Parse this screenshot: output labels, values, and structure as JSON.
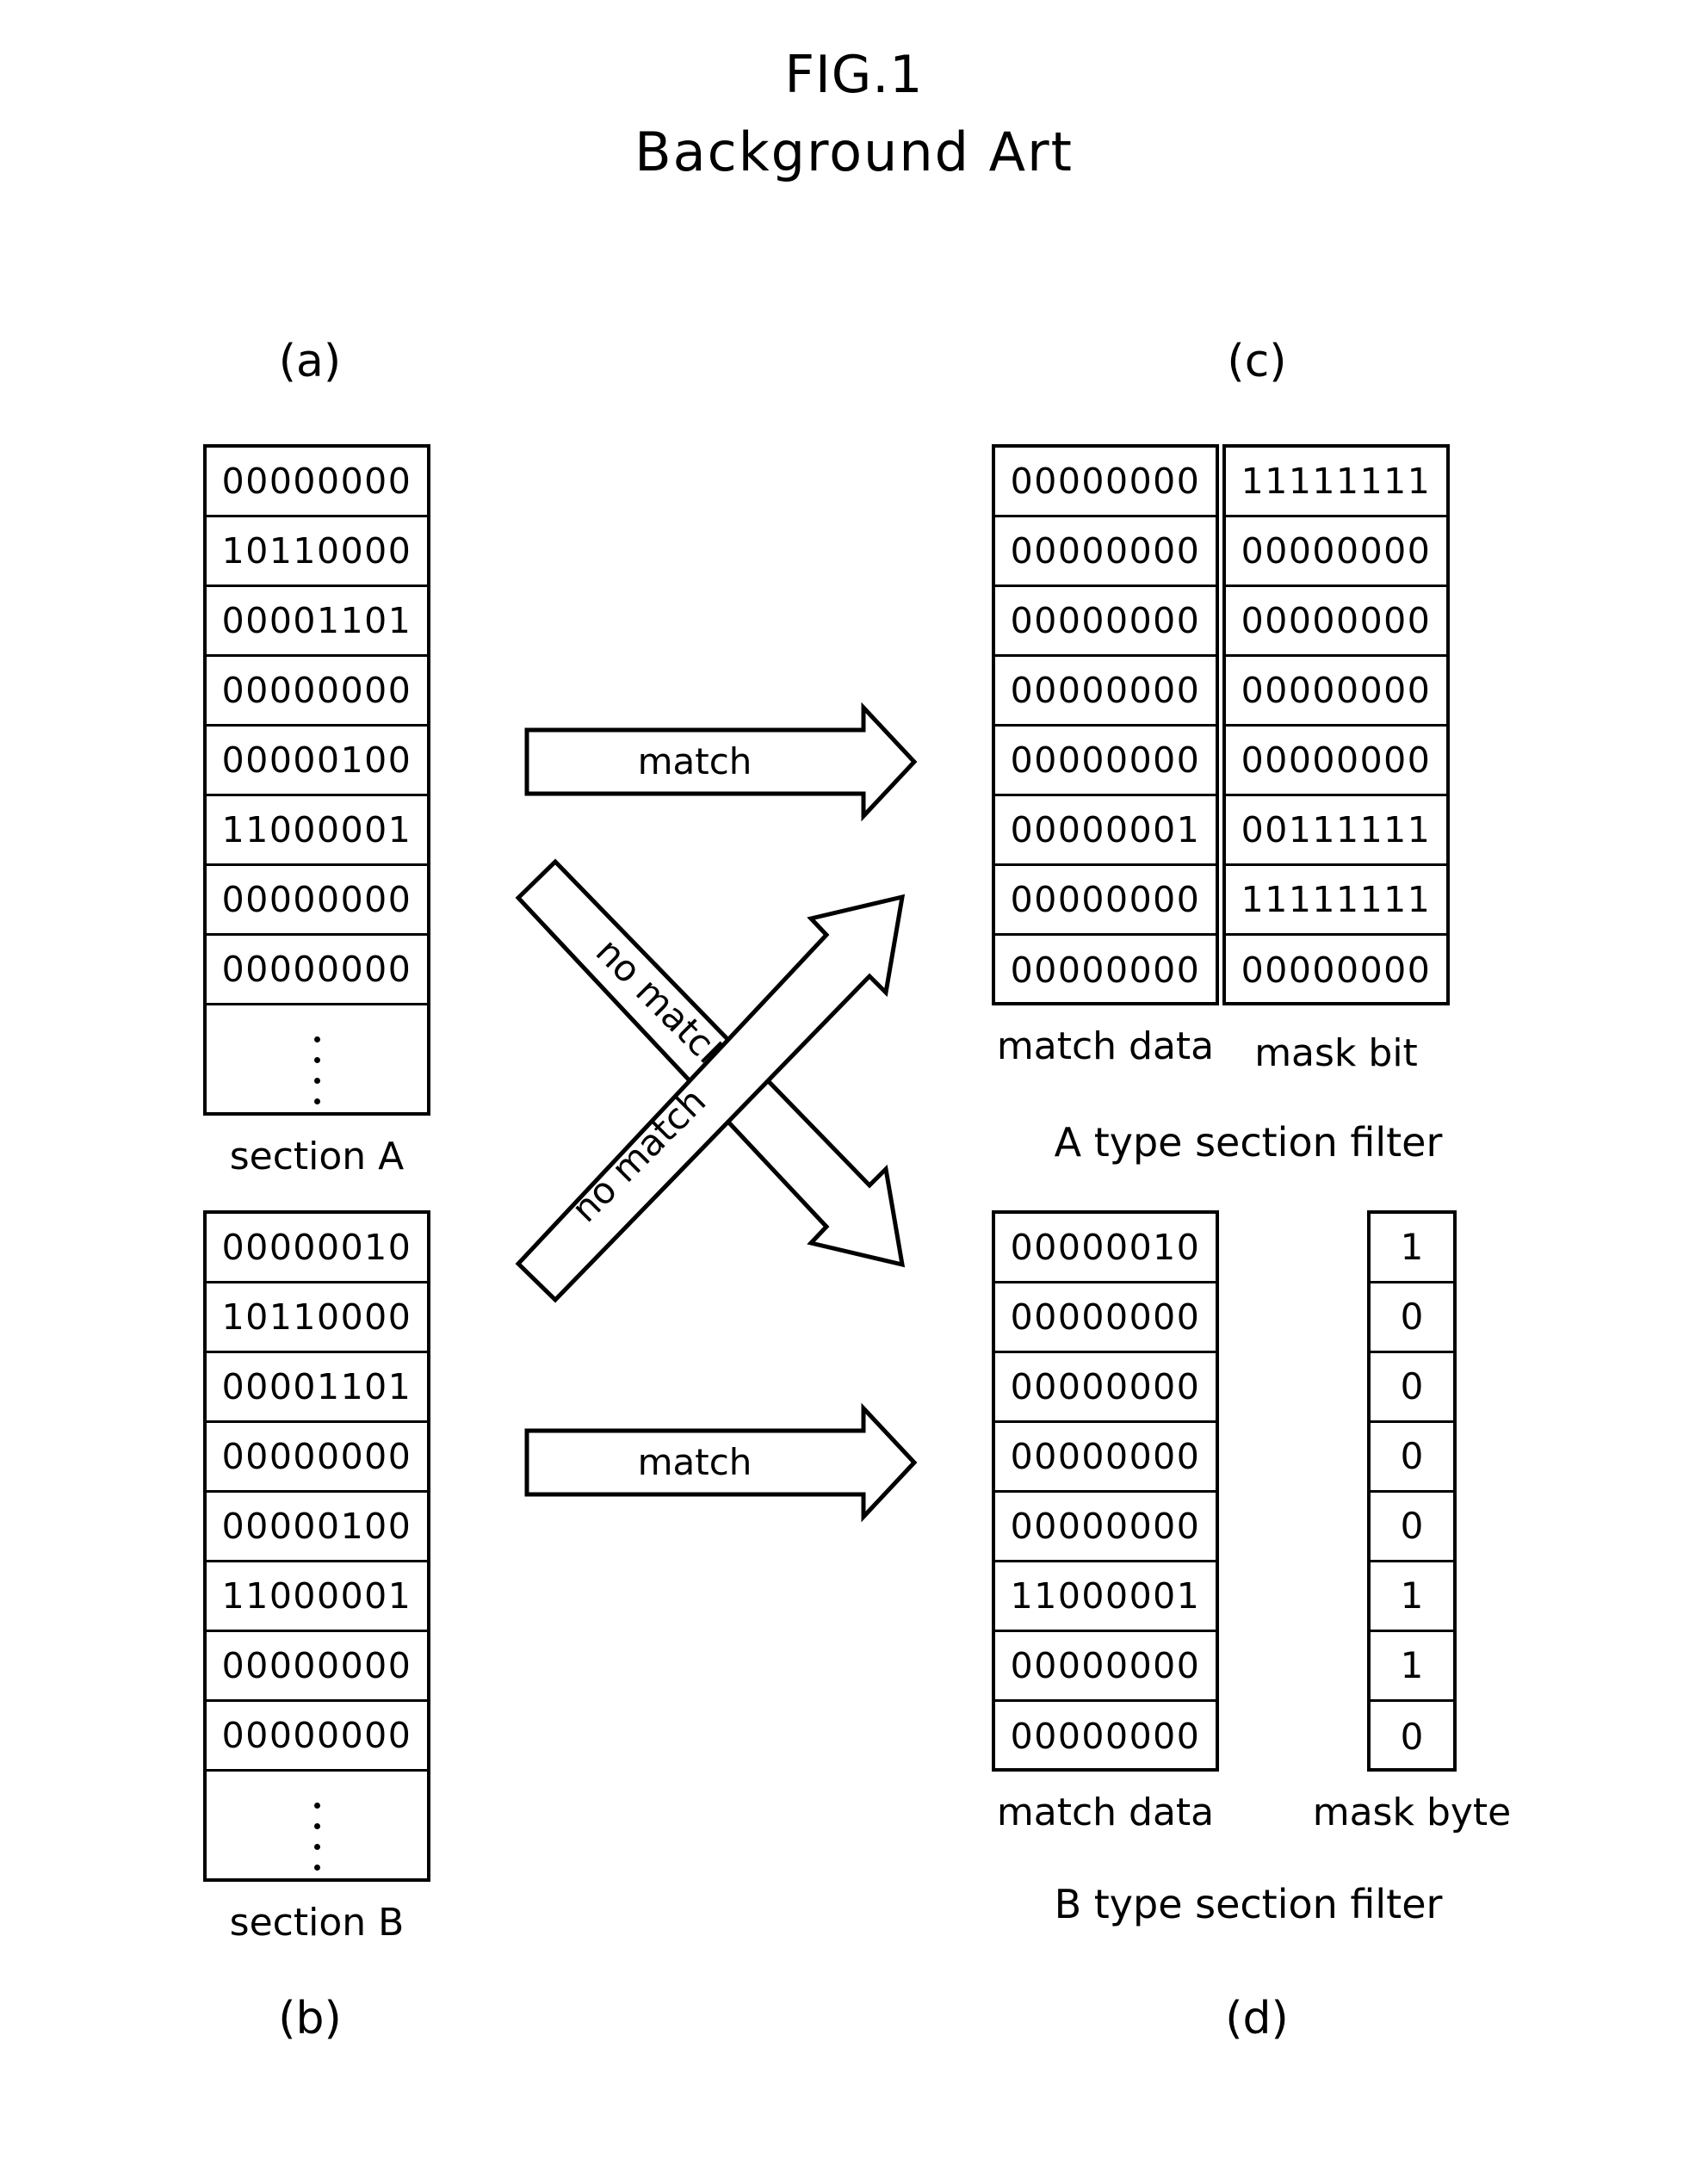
{
  "figure": {
    "title": "FIG.1",
    "subtitle": "Background  Art"
  },
  "panels": {
    "a": "(a)",
    "b": "(b)",
    "c": "(c)",
    "d": "(d)"
  },
  "section_a": {
    "caption": "section  A",
    "rows": [
      "00000000",
      "10110000",
      "00001101",
      "00000000",
      "00000100",
      "11000001",
      "00000000",
      "00000000"
    ],
    "ellipsis_dots": 4
  },
  "section_b": {
    "caption": "section  B",
    "rows": [
      "00000010",
      "10110000",
      "00001101",
      "00000000",
      "00000100",
      "11000001",
      "00000000",
      "00000000"
    ],
    "ellipsis_dots": 4
  },
  "a_type_filter": {
    "title": "A  type  section  filter",
    "match_data_caption": "match  data",
    "mask_caption": "mask  bit",
    "match_data": [
      "00000000",
      "00000000",
      "00000000",
      "00000000",
      "00000000",
      "00000001",
      "00000000",
      "00000000"
    ],
    "mask": [
      "11111111",
      "00000000",
      "00000000",
      "00000000",
      "00000000",
      "00111111",
      "11111111",
      "00000000"
    ]
  },
  "b_type_filter": {
    "title": "B  type  section  filter",
    "match_data_caption": "match  data",
    "mask_caption": "mask  byte",
    "match_data": [
      "00000010",
      "00000000",
      "00000000",
      "00000000",
      "00000000",
      "11000001",
      "00000000",
      "00000000"
    ],
    "mask": [
      "1",
      "0",
      "0",
      "0",
      "0",
      "1",
      "1",
      "0"
    ]
  },
  "arrows": {
    "top_match": "match",
    "bottom_match": "match",
    "cross_down": "no  match",
    "cross_up": "no  match"
  },
  "colors": {
    "ink": "#000000",
    "paper": "#ffffff"
  }
}
